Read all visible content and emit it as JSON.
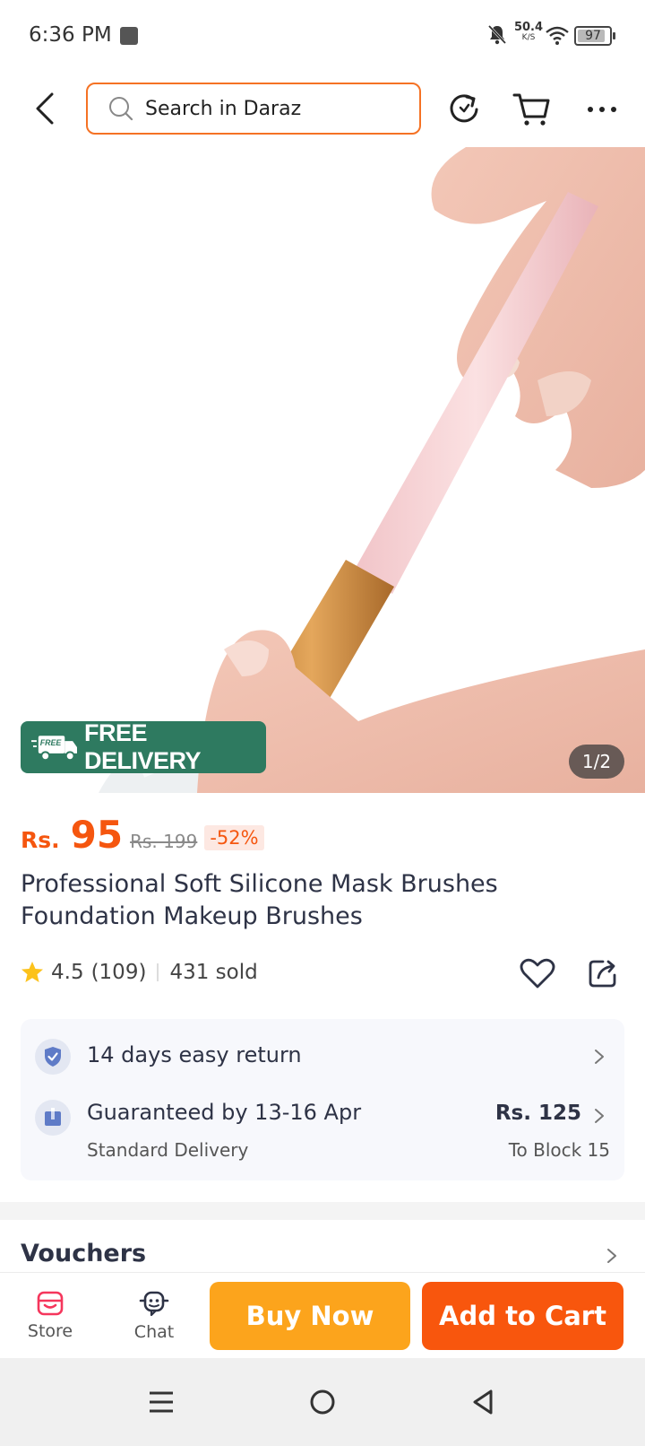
{
  "status_bar": {
    "time": "6:36 PM",
    "net_speed": "50.4",
    "net_unit": "K/S",
    "battery": "97",
    "icons": [
      "notification-square-icon",
      "bell-muted-icon",
      "wifi-icon",
      "battery-icon"
    ]
  },
  "header": {
    "search_placeholder": "Search in Daraz",
    "icons": [
      "back-arrow-icon",
      "search-icon",
      "refresh-icon",
      "cart-icon",
      "more-icon"
    ],
    "accent": "#f57224"
  },
  "gallery": {
    "badge_small": "FREE",
    "badge_label": "FREE DELIVERY",
    "badge_color": "#2e7a60",
    "counter": "1/2"
  },
  "product": {
    "currency": "Rs.",
    "price": "95",
    "original_price": "Rs. 199",
    "discount": "-52%",
    "price_color": "#f5560f",
    "title": "Professional Soft Silicone Mask Brushes Foundation Makeup Brushes",
    "rating": "4.5",
    "review_count": "(109)",
    "sold": "431 sold",
    "icons": [
      "star-icon",
      "heart-icon",
      "share-icon"
    ]
  },
  "service": {
    "return_label": "14 days easy return",
    "delivery_label": "Guaranteed by 13-16 Apr",
    "delivery_type": "Standard Delivery",
    "delivery_price": "Rs. 125",
    "delivery_destination": "To Block 15",
    "icons": [
      "shield-check-icon",
      "parcel-icon",
      "chevron-right-icon"
    ]
  },
  "vouchers": {
    "title": "Vouchers"
  },
  "bottom_bar": {
    "store_label": "Store",
    "chat_label": "Chat",
    "buy_now": "Buy Now",
    "add_to_cart": "Add to Cart",
    "buy_color": "#fca41c",
    "cart_color": "#f8560d",
    "icons": [
      "store-icon",
      "chat-icon"
    ]
  },
  "system_nav": {
    "icons": [
      "menu-icon",
      "home-circle-icon",
      "back-triangle-icon"
    ]
  }
}
